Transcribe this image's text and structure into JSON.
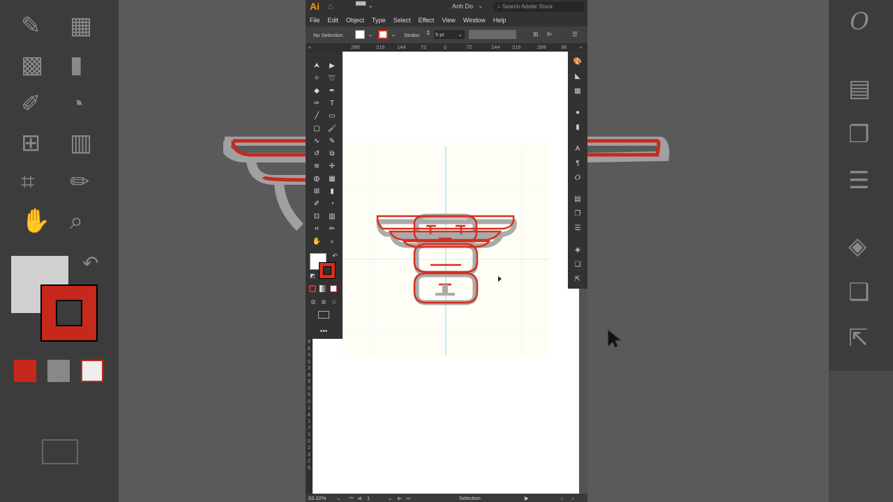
{
  "app": {
    "logo": "Ai",
    "user": "Anh Do",
    "search_placeholder": "Search Adobe Stock"
  },
  "menu": [
    "File",
    "Edit",
    "Object",
    "Type",
    "Select",
    "Effect",
    "View",
    "Window",
    "Help"
  ],
  "control_bar": {
    "selection": "No Selection",
    "stroke_label": "Stroke:",
    "stroke_value": "5 pt"
  },
  "ruler": {
    "h_ticks": [
      "288",
      "216",
      "144",
      "72",
      "0",
      "72",
      "144",
      "216",
      "288",
      "36"
    ],
    "v_ticks": [
      "9",
      "6",
      "3",
      "0",
      "3",
      "6",
      "9",
      "0",
      "5",
      "0",
      "1",
      "4",
      "1",
      "7",
      "1",
      "0",
      "2",
      "3",
      "2",
      "6"
    ]
  },
  "status_bar": {
    "zoom": "63.32%",
    "artboard": "1",
    "tool": "Selection"
  },
  "colors": {
    "accent": "#d62e1f",
    "ui_dark": "#323232",
    "ai_orange": "#ff9a00",
    "guide": "#8ad4f0"
  },
  "icons": {
    "toolbar": [
      "selection-tool",
      "direct-selection-tool",
      "magic-wand-tool",
      "lasso-tool",
      "eraser-tool",
      "pen-tool",
      "curvature-tool",
      "type-tool",
      "line-tool",
      "rectangle-tool",
      "rectangle-frame-tool",
      "paintbrush-tool",
      "blob-brush-tool",
      "pencil-tool",
      "rotate-tool",
      "scale-tool",
      "warp-tool",
      "puppet-warp-tool",
      "shape-builder-tool",
      "perspective-grid-tool",
      "mesh-tool",
      "gradient-tool",
      "eyedropper-tool",
      "blend-tool",
      "symbol-sprayer-tool",
      "column-graph-tool",
      "artboard-tool",
      "slice-tool",
      "hand-tool",
      "zoom-tool"
    ],
    "right_panel": [
      "color-icon",
      "color-guide-icon",
      "swatches-icon",
      "appearance-icon",
      "gradient-icon",
      "character-icon",
      "paragraph-icon",
      "opentype-icon",
      "align-icon",
      "pathfinder-icon",
      "transform-icon",
      "layers-icon",
      "artboards-icon",
      "export-icon"
    ]
  }
}
